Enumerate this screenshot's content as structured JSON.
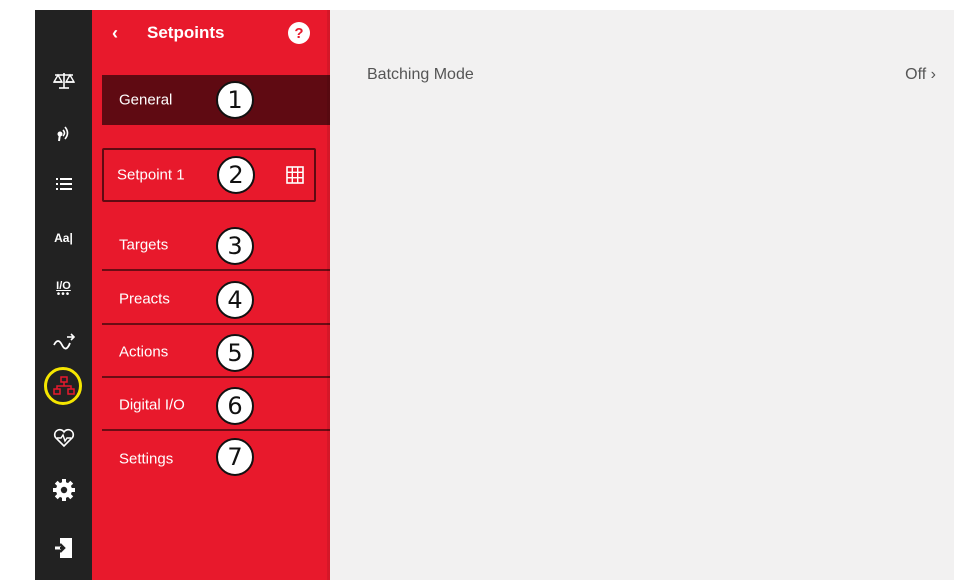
{
  "panel": {
    "title": "Setpoints",
    "back_glyph": "‹",
    "help_glyph": "?"
  },
  "nav": {
    "items": [
      {
        "label": "General",
        "badge": "1",
        "state": "active"
      },
      {
        "label": "Setpoint 1",
        "badge": "2",
        "state": "bordered",
        "icon": "grid-icon"
      },
      {
        "label": "Targets",
        "badge": "3"
      },
      {
        "label": "Preacts",
        "badge": "4"
      },
      {
        "label": "Actions",
        "badge": "5"
      },
      {
        "label": "Digital I/O",
        "badge": "6"
      },
      {
        "label": "Settings",
        "badge": "7"
      }
    ]
  },
  "rail": {
    "items": [
      {
        "icon": "scale-icon"
      },
      {
        "icon": "wireless-icon"
      },
      {
        "icon": "list-icon"
      },
      {
        "icon": "text-icon",
        "text": "Aa|"
      },
      {
        "icon": "io-icon",
        "text": "I/O"
      },
      {
        "icon": "signal-icon"
      },
      {
        "icon": "network-icon",
        "highlighted": true
      },
      {
        "icon": "health-icon"
      },
      {
        "icon": "gear-icon"
      },
      {
        "icon": "logout-icon"
      }
    ]
  },
  "content": {
    "rows": [
      {
        "label": "Batching Mode",
        "value": "Off ›"
      }
    ]
  },
  "colors": {
    "rail_bg": "#222222",
    "panel_bg": "#e8192c",
    "panel_active": "#5f0a12",
    "content_bg": "#f2f1f1",
    "highlight": "#f5e600"
  }
}
